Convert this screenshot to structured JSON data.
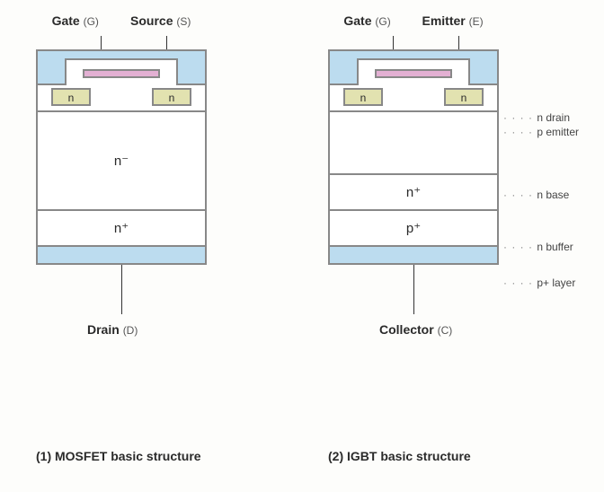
{
  "mosfet": {
    "gate_label": "Gate",
    "gate_sym": "(G)",
    "source_label": "Source",
    "source_sym": "(S)",
    "well_n": "n",
    "layer_nminus": "n⁻",
    "layer_nplus": "n⁺",
    "drain_label": "Drain",
    "drain_sym": "(D)",
    "caption": "(1) MOSFET basic structure"
  },
  "igbt": {
    "gate_label": "Gate",
    "gate_sym": "(G)",
    "emitter_label": "Emitter",
    "emitter_sym": "(E)",
    "well_n": "n",
    "layer_nplus": "n⁺",
    "layer_pplus": "p⁺",
    "collector_label": "Collector",
    "collector_sym": "(C)",
    "caption": "(2) IGBT basic structure"
  },
  "annotations": {
    "n_drain": "n drain",
    "p_emitter": "p emitter",
    "n_base": "n base",
    "n_buffer": "n buffer",
    "p_plus_layer": "p+ layer"
  }
}
